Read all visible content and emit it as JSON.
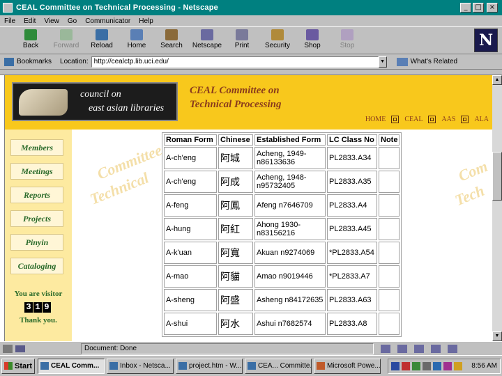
{
  "window": {
    "title": "CEAL Committee on Technical Processing - Netscape",
    "buttons": {
      "minimize": "_",
      "maximize": "□",
      "close": "×"
    }
  },
  "menu": [
    "File",
    "Edit",
    "View",
    "Go",
    "Communicator",
    "Help"
  ],
  "toolbar": {
    "back": "Back",
    "forward": "Forward",
    "reload": "Reload",
    "home": "Home",
    "search": "Search",
    "netscape": "Netscape",
    "print": "Print",
    "security": "Security",
    "shop": "Shop",
    "stop": "Stop",
    "logo": "N"
  },
  "location": {
    "bookmarks_label": "Bookmarks",
    "location_label": "Location:",
    "url": "http://cealctp.lib.uci.edu/",
    "whats_related": "What's Related"
  },
  "banner": {
    "logo_line1": "council on",
    "logo_line2": "east asian libraries",
    "title_line1": "CEAL Committee on",
    "title_line2": "Technical Processing",
    "nav": [
      "HOME",
      "CEAL",
      "AAS",
      "ALA"
    ]
  },
  "sidebar": {
    "items": [
      "Members",
      "Meetings",
      "Reports",
      "Projects",
      "Pinyin",
      "Cataloging"
    ],
    "visitor_label": "You are visitor",
    "visitor_digits": [
      "3",
      "1",
      "9"
    ],
    "thanks": "Thank you."
  },
  "watermark": {
    "line1": "Committee",
    "line2": "Technical",
    "right1": "Com",
    "right2": "Tech"
  },
  "table": {
    "headers": [
      "Roman Form",
      "Chinese",
      "Established Form",
      "LC Class No",
      "Note"
    ],
    "rows": [
      {
        "roman": "A-ch'eng",
        "chinese": "阿城",
        "established": "Acheng, 1949- n86133636",
        "lc": "PL2833.A34",
        "note": ""
      },
      {
        "roman": "A-ch'eng",
        "chinese": "阿成",
        "established": "Acheng, 1948- n95732405",
        "lc": "PL2833.A35",
        "note": ""
      },
      {
        "roman": "A-feng",
        "chinese": "阿鳳",
        "established": "Afeng n7646709",
        "lc": "PL2833.A4",
        "note": ""
      },
      {
        "roman": "A-hung",
        "chinese": "阿紅",
        "established": "Ahong 1930- n83156216",
        "lc": "PL2833.A45",
        "note": ""
      },
      {
        "roman": "A-k'uan",
        "chinese": "阿寬",
        "established": "Akuan n9274069",
        "lc": "*PL2833.A54",
        "note": ""
      },
      {
        "roman": "A-mao",
        "chinese": "阿貓",
        "established": "Amao n9019446",
        "lc": "*PL2833.A7",
        "note": ""
      },
      {
        "roman": "A-sheng",
        "chinese": "阿盛",
        "established": "Asheng n84172635",
        "lc": "PL2833.A63",
        "note": ""
      },
      {
        "roman": "A-shui",
        "chinese": "阿水",
        "established": "Ashui n7682574",
        "lc": "PL2833.A8",
        "note": ""
      }
    ]
  },
  "status": {
    "message": "Document: Done"
  },
  "taskbar": {
    "start": "Start",
    "tasks": [
      "CEAL Comm...",
      "Inbox - Netsca...",
      "project.htm - W...",
      "CEA... Committe...",
      "Microsoft Powe..."
    ],
    "clock": "8:56 AM"
  }
}
